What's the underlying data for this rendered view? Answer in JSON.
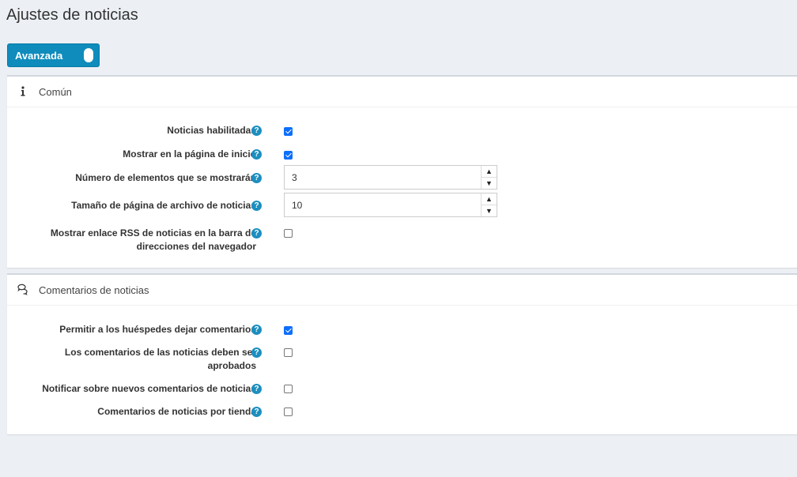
{
  "page": {
    "title": "Ajustes de noticias"
  },
  "advanced_toggle": {
    "label": "Avanzada"
  },
  "common_section": {
    "title": "Común",
    "icon": "info-icon",
    "settings": [
      {
        "label": "Noticias habilitadas",
        "checked": true
      },
      {
        "label": "Mostrar en la página de inicio",
        "checked": true
      },
      {
        "label": "Número de elementos que se mostrarán",
        "value": "3"
      },
      {
        "label": "Tamaño de página de archivo de noticias",
        "value": "10"
      },
      {
        "label_line1": "Mostrar enlace RSS de noticias en la barra de",
        "label_line2": "direcciones del navegador",
        "checked": false
      }
    ]
  },
  "comments_section": {
    "title": "Comentarios de noticias",
    "icon": "comments-icon",
    "settings": [
      {
        "label": "Permitir a los huéspedes dejar comentarios",
        "checked": true
      },
      {
        "label_line1": "Los comentarios de las noticias deben ser",
        "label_line2": "aprobados",
        "checked": false
      },
      {
        "label": "Notificar sobre nuevos comentarios de noticias",
        "checked": false
      },
      {
        "label": "Comentarios de noticias por tienda",
        "checked": false
      }
    ]
  },
  "help_glyph": "?",
  "spin_up_glyph": "▲",
  "spin_down_glyph": "▼",
  "colors": {
    "accent": "#0f8cbc",
    "help": "#1c8ec0",
    "checkbox": "#0d6efd",
    "background": "#ecf0f5"
  }
}
